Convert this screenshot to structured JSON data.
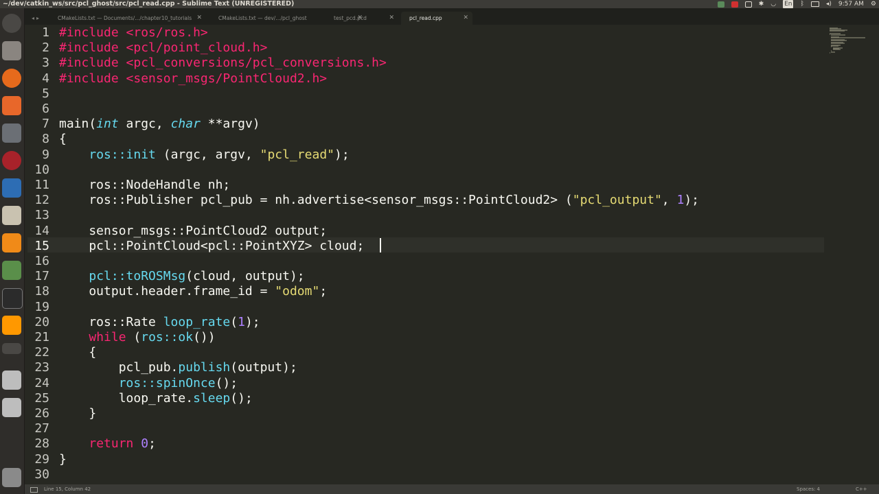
{
  "window": {
    "title": "~/dev/catkin_ws/src/pcl_ghost/src/pcl_read.cpp - Sublime Text (UNREGISTERED)"
  },
  "system": {
    "keyboard_layout": "En",
    "clock": "9:57 AM"
  },
  "tabs": [
    {
      "label": "CMakeLists.txt — Documents/.../chapter10_tutorials",
      "active": false
    },
    {
      "label": "CMakeLists.txt — dev/.../pcl_ghost",
      "active": false
    },
    {
      "label": "test_pcd.pcd",
      "active": false
    },
    {
      "label": "pcl_read.cpp",
      "active": true
    }
  ],
  "editor": {
    "current_line": 15,
    "lines": [
      [
        [
          "pp",
          "#include <ros/ros.h>"
        ]
      ],
      [
        [
          "pp",
          "#include <pcl/point_cloud.h>"
        ]
      ],
      [
        [
          "pp",
          "#include <pcl_conversions/pcl_conversions.h>"
        ]
      ],
      [
        [
          "pp",
          "#include <sensor_msgs/PointCloud2.h>"
        ]
      ],
      [],
      [],
      [
        [
          "",
          "main("
        ],
        [
          "ty",
          "int"
        ],
        [
          "",
          " argc, "
        ],
        [
          "ty",
          "char"
        ],
        [
          "",
          " **argv)"
        ]
      ],
      [
        [
          "",
          "{"
        ]
      ],
      [
        [
          "",
          "    "
        ],
        [
          "fn",
          "ros::init"
        ],
        [
          "",
          " (argc, argv, "
        ],
        [
          "st",
          "\"pcl_read\""
        ],
        [
          "",
          ");"
        ]
      ],
      [],
      [
        [
          "",
          "    ros::NodeHandle nh;"
        ]
      ],
      [
        [
          "",
          "    ros::Publisher pcl_pub = nh.advertise<sensor_msgs::PointCloud2> ("
        ],
        [
          "st",
          "\"pcl_output\""
        ],
        [
          "",
          ", "
        ],
        [
          "nm",
          "1"
        ],
        [
          "",
          ");"
        ]
      ],
      [],
      [
        [
          "",
          "    sensor_msgs::PointCloud2 output;"
        ]
      ],
      [
        [
          "",
          "    pcl::PointCloud<pcl::PointXYZ> cloud;"
        ]
      ],
      [],
      [
        [
          "",
          "    "
        ],
        [
          "fn",
          "pcl::toROSMsg"
        ],
        [
          "",
          "(cloud, output);"
        ]
      ],
      [
        [
          "",
          "    output.header.frame_id = "
        ],
        [
          "st",
          "\"odom\""
        ],
        [
          "",
          ";"
        ]
      ],
      [],
      [
        [
          "",
          "    ros::Rate "
        ],
        [
          "fn",
          "loop_rate"
        ],
        [
          "",
          "("
        ],
        [
          "nm",
          "1"
        ],
        [
          "",
          ");"
        ]
      ],
      [
        [
          "",
          "    "
        ],
        [
          "kw",
          "while"
        ],
        [
          "",
          " ("
        ],
        [
          "fn",
          "ros::ok"
        ],
        [
          "",
          "())"
        ]
      ],
      [
        [
          "",
          "    {"
        ]
      ],
      [
        [
          "",
          "        pcl_pub."
        ],
        [
          "fn",
          "publish"
        ],
        [
          "",
          "(output);"
        ]
      ],
      [
        [
          "",
          "        "
        ],
        [
          "fn",
          "ros::spinOnce"
        ],
        [
          "",
          "();"
        ]
      ],
      [
        [
          "",
          "        loop_rate."
        ],
        [
          "fn",
          "sleep"
        ],
        [
          "",
          "();"
        ]
      ],
      [
        [
          "",
          "    }"
        ]
      ],
      [],
      [
        [
          "",
          "    "
        ],
        [
          "kw",
          "return"
        ],
        [
          "",
          " "
        ],
        [
          "nm",
          "0"
        ],
        [
          "",
          ";"
        ]
      ],
      [
        [
          "",
          "}"
        ]
      ],
      []
    ]
  },
  "status": {
    "position": "Line 15, Column 42",
    "indentation": "Spaces: 4",
    "syntax": "C++"
  },
  "colors": {
    "background": "#272822",
    "keyword": "#f92672",
    "string": "#e6db74",
    "function": "#66d9ef",
    "number": "#ae81ff"
  }
}
